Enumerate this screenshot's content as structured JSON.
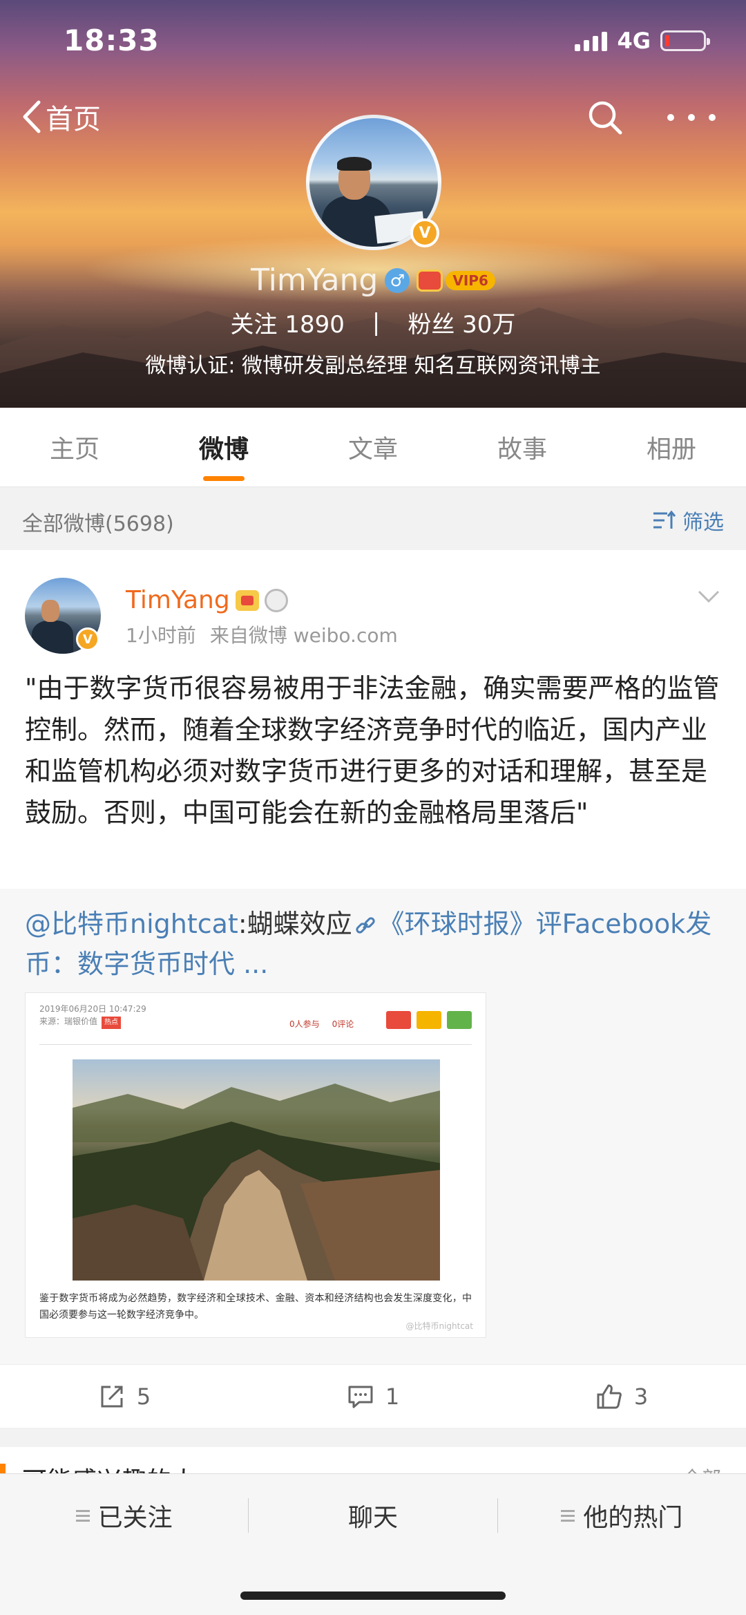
{
  "status": {
    "time": "18:33",
    "network": "4G"
  },
  "nav": {
    "back_label": "首页"
  },
  "profile": {
    "name": "TimYang",
    "vip_label": "VIP6",
    "following_label": "关注",
    "following_count": "1890",
    "separator": "|",
    "followers_label": "粉丝",
    "followers_count": "30万",
    "certification": "微博认证: 微博研发副总经理 知名互联网资讯博主"
  },
  "tabs": [
    {
      "label": "主页"
    },
    {
      "label": "微博"
    },
    {
      "label": "文章"
    },
    {
      "label": "故事"
    },
    {
      "label": "相册"
    }
  ],
  "filter": {
    "count_label": "全部微博(5698)",
    "filter_label": "筛选"
  },
  "post": {
    "author": "TimYang",
    "time": "1小时前",
    "source": "来自微博 weibo.com",
    "text": "\"由于数字货币很容易被用于非法金融，确实需要严格的监管控制。然而，随着全球数字经济竞争时代的临近，国内产业和监管机构必须对数字货币进行更多的对话和理解，甚至是鼓励。否则，中国可能会在新的金融格局里落后\"",
    "repost": {
      "mention": "@比特币nightcat",
      "mention_suffix": ":蝴蝶效应",
      "link_text": "《环球时报》评Facebook发币：数字货币时代 ..."
    },
    "image": {
      "date": "2019年06月20日 10:47:29",
      "source": "来源：瑞银价值",
      "tag": "热点",
      "participants": "0人参与",
      "comments": "0评论",
      "caption": "鉴于数字货币将成为必然趋势，数字经济和全球技术、金融、资本和经济结构也会发生深度变化，中国必须要参与这一轮数字经济竞争中。",
      "watermark": "@比特币nightcat"
    },
    "actions": {
      "reposts": "5",
      "comments": "1",
      "likes": "3"
    }
  },
  "next_section": {
    "title": "可能感兴趣的人",
    "more": "全部"
  },
  "bottom_bar": {
    "following": "已关注",
    "chat": "聊天",
    "hot": "他的热门"
  },
  "colors": {
    "accent": "#ff8200",
    "link": "#4a7fb5",
    "name": "#f06a1d"
  }
}
